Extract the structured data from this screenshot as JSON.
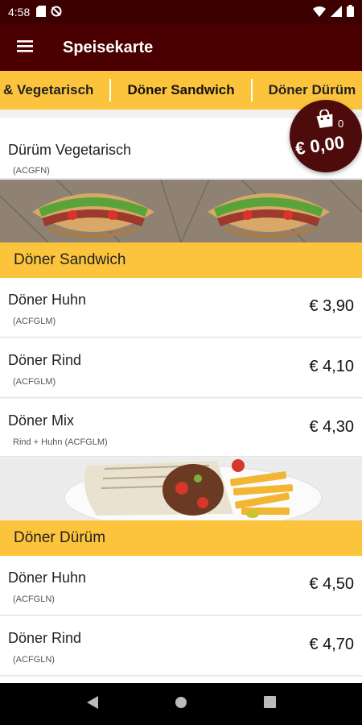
{
  "status_bar": {
    "time": "4:58",
    "icons": [
      "sd-card-icon",
      "sync-off-icon",
      "wifi-icon",
      "signal-icon",
      "battery-icon"
    ]
  },
  "app_bar": {
    "title": "Speisekarte",
    "menu_icon": "hamburger-menu-icon"
  },
  "tabs": [
    {
      "label": "& Vegetarisch"
    },
    {
      "label": "Döner Sandwich"
    },
    {
      "label": "Döner Dürüm"
    }
  ],
  "cart": {
    "count": "0",
    "total": "€ 0,00",
    "icon": "shopping-bag-icon"
  },
  "top_item": {
    "name": "Dürüm Vegetarisch",
    "allergens": "(ACGFN)"
  },
  "sections": [
    {
      "title": "Döner Sandwich",
      "items": [
        {
          "name": "Döner Huhn",
          "allergens": "(ACFGLM)",
          "price": "€ 3,90"
        },
        {
          "name": "Döner Rind",
          "allergens": "(ACFGLM)",
          "price": "€ 4,10"
        },
        {
          "name": "Döner Mix",
          "allergens": "Rind + Huhn (ACFGLM)",
          "price": "€ 4,30"
        }
      ]
    },
    {
      "title": "Döner Dürüm",
      "items": [
        {
          "name": "Döner Huhn",
          "allergens": "(ACFGLN)",
          "price": "€ 4,50"
        },
        {
          "name": "Döner Rind",
          "allergens": "(ACFGLN)",
          "price": "€ 4,70"
        }
      ]
    }
  ],
  "colors": {
    "status_bar": "#3d0000",
    "app_bar": "#4a0000",
    "accent": "#fcc43c",
    "cart": "#4e0b0b"
  }
}
